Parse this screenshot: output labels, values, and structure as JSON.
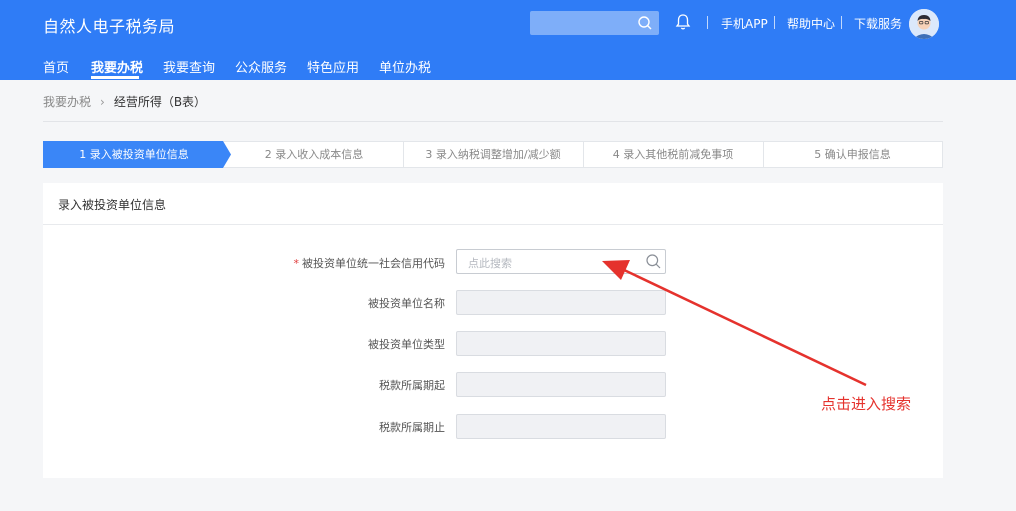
{
  "header": {
    "title": "自然人电子税务局",
    "links": [
      "手机APP",
      "帮助中心",
      "下载服务"
    ]
  },
  "nav": {
    "items": [
      "首页",
      "我要办税",
      "我要查询",
      "公众服务",
      "特色应用",
      "单位办税"
    ],
    "active": "我要办税"
  },
  "breadcrumb": {
    "parent": "我要办税",
    "current": "经营所得（B表）"
  },
  "steps": [
    "1  录入被投资单位信息",
    "2  录入收入成本信息",
    "3  录入纳税调整增加/减少额",
    "4  录入其他税前减免事项",
    "5  确认申报信息"
  ],
  "panel": {
    "title": "录入被投资单位信息",
    "fields": [
      {
        "label": "被投资单位统一社会信用代码",
        "required": true,
        "placeholder": "点此搜索",
        "value": ""
      },
      {
        "label": "被投资单位名称",
        "required": false,
        "value": ""
      },
      {
        "label": "被投资单位类型",
        "required": false,
        "value": ""
      },
      {
        "label": "税款所属期起",
        "required": false,
        "value": ""
      },
      {
        "label": "税款所属期止",
        "required": false,
        "value": ""
      }
    ]
  },
  "annotation": {
    "text": "点击进入搜索",
    "color": "#e5322d"
  },
  "colors": {
    "brand": "#2f7cf6",
    "step_active": "#3a86f7"
  }
}
